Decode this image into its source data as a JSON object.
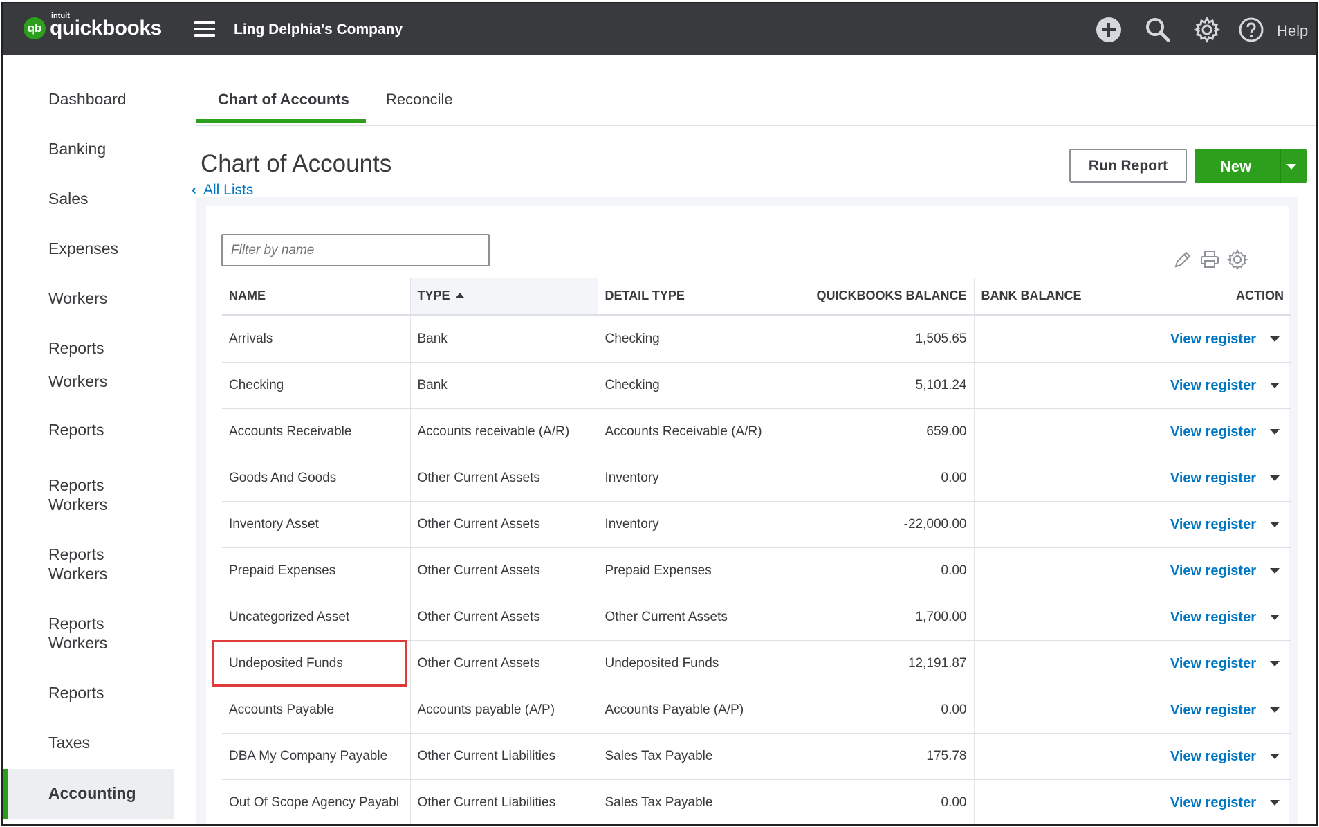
{
  "app": {
    "logo_intuit": "intuit",
    "logo_text": "quickbooks",
    "logo_mark": "qb",
    "company": "Ling Delphia's Company",
    "help_label": "Help"
  },
  "icons": {
    "hamburger": "menu-icon",
    "create": "plus-circle-icon",
    "search": "search-icon",
    "settings": "gear-icon",
    "help": "question-circle-icon",
    "edit": "pencil-icon",
    "print": "printer-icon",
    "table_settings": "gear-icon"
  },
  "colors": {
    "accent": "#2ca01c",
    "link": "#0077c5",
    "topbar": "#393a3d",
    "highlight": "#e03b3b"
  },
  "sidebar": {
    "items": [
      {
        "label": "Dashboard"
      },
      {
        "label": "Banking"
      },
      {
        "label": "Sales"
      },
      {
        "label": "Expenses"
      },
      {
        "label": "Workers"
      },
      {
        "label": "Reports"
      },
      {
        "label": "Workers"
      },
      {
        "label": "Reports"
      },
      {
        "label": "Reports"
      },
      {
        "label": "Workers"
      },
      {
        "label": "Reports"
      },
      {
        "label": "Workers"
      },
      {
        "label": "Reports"
      },
      {
        "label": "Workers"
      },
      {
        "label": "Reports"
      },
      {
        "label": "Taxes"
      },
      {
        "label": "Accounting"
      }
    ],
    "active": "Accounting"
  },
  "tabs": [
    {
      "label": "Chart of Accounts",
      "active": true
    },
    {
      "label": "Reconcile",
      "active": false
    }
  ],
  "page": {
    "title": "Chart of Accounts",
    "back_link": "All Lists",
    "run_report": "Run Report",
    "new_button": "New",
    "filter_placeholder": "Filter by name"
  },
  "table": {
    "columns": [
      "NAME",
      "TYPE",
      "DETAIL TYPE",
      "QUICKBOOKS BALANCE",
      "BANK BALANCE",
      "ACTION"
    ],
    "sorted_column": "TYPE",
    "action_label": "View register",
    "rows": [
      {
        "name": "Arrivals",
        "type": "Bank",
        "detail": "Checking",
        "qb_balance": "1,505.65",
        "bank_balance": ""
      },
      {
        "name": "Checking",
        "type": "Bank",
        "detail": "Checking",
        "qb_balance": "5,101.24",
        "bank_balance": ""
      },
      {
        "name": "Accounts Receivable",
        "type": "Accounts receivable (A/R)",
        "detail": "Accounts Receivable (A/R)",
        "qb_balance": "659.00",
        "bank_balance": ""
      },
      {
        "name": "Goods And Goods",
        "type": "Other Current Assets",
        "detail": "Inventory",
        "qb_balance": "0.00",
        "bank_balance": ""
      },
      {
        "name": "Inventory Asset",
        "type": "Other Current Assets",
        "detail": "Inventory",
        "qb_balance": "-22,000.00",
        "bank_balance": ""
      },
      {
        "name": "Prepaid Expenses",
        "type": "Other Current Assets",
        "detail": "Prepaid Expenses",
        "qb_balance": "0.00",
        "bank_balance": ""
      },
      {
        "name": "Uncategorized Asset",
        "type": "Other Current Assets",
        "detail": "Other Current Assets",
        "qb_balance": "1,700.00",
        "bank_balance": ""
      },
      {
        "name": "Undeposited Funds",
        "type": "Other Current Assets",
        "detail": "Undeposited Funds",
        "qb_balance": "12,191.87",
        "bank_balance": ""
      },
      {
        "name": "Accounts Payable",
        "type": "Accounts payable (A/P)",
        "detail": "Accounts Payable (A/P)",
        "qb_balance": "0.00",
        "bank_balance": ""
      },
      {
        "name": "DBA My Company Payable",
        "type": "Other Current Liabilities",
        "detail": "Sales Tax Payable",
        "qb_balance": "175.78",
        "bank_balance": ""
      },
      {
        "name": "Out Of Scope Agency Payabl",
        "type": "Other Current Liabilities",
        "detail": "Sales Tax Payable",
        "qb_balance": "0.00",
        "bank_balance": ""
      }
    ]
  }
}
